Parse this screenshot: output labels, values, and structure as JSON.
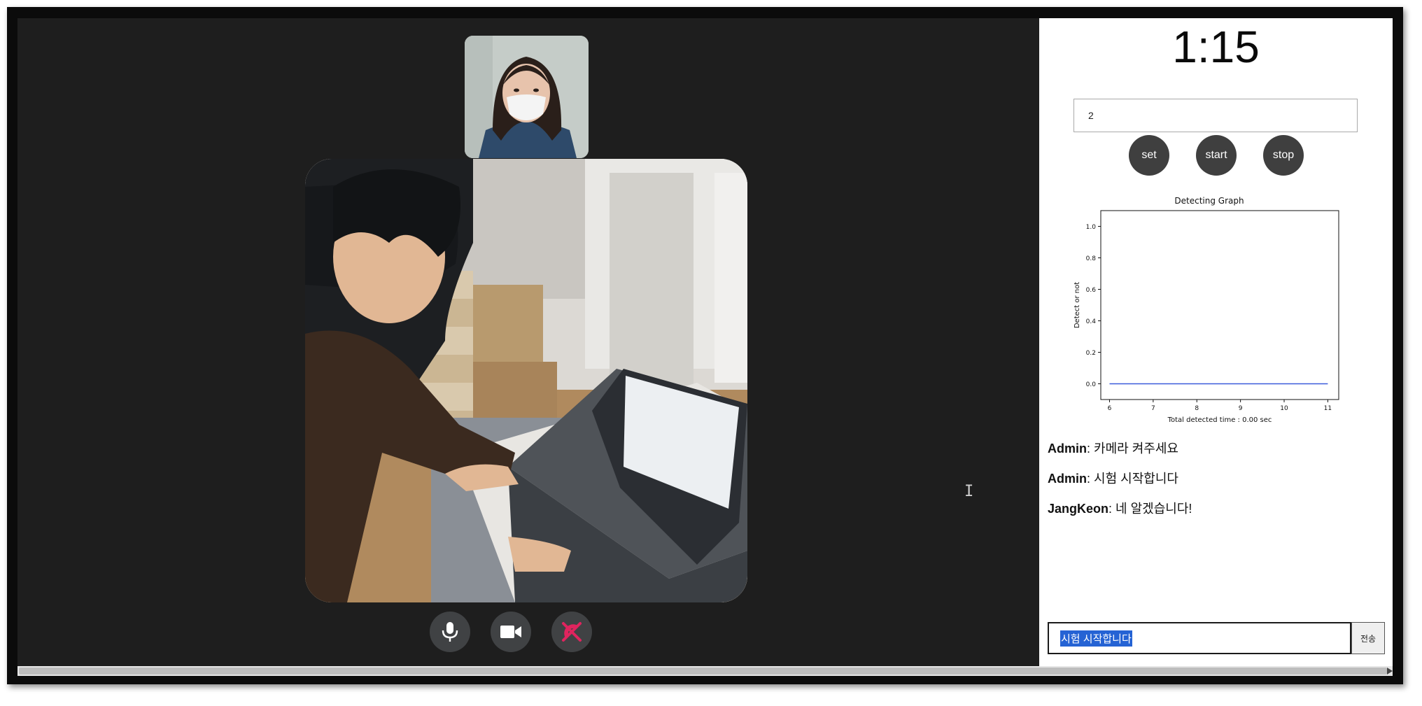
{
  "controls": {
    "mic_icon": "microphone-icon",
    "camera_icon": "video-camera-icon",
    "hangup_icon": "end-call-icon",
    "hangup_color": "#e0245e"
  },
  "panel": {
    "timer": "1:15",
    "count_value": "2",
    "set_label": "set",
    "start_label": "start",
    "stop_label": "stop"
  },
  "chart_data": {
    "type": "line",
    "title": "Detecting Graph",
    "xlabel": "Total detected time : 0.00 sec",
    "ylabel": "Detect or not",
    "xlim": [
      5.8,
      11.25
    ],
    "ylim": [
      -0.1,
      1.1
    ],
    "x_ticks": [
      6,
      7,
      8,
      9,
      10,
      11
    ],
    "y_ticks": [
      0.0,
      0.2,
      0.4,
      0.6,
      0.8,
      1.0
    ],
    "y_tick_labels": [
      "0.0",
      "0.2",
      "0.4",
      "0.6",
      "0.8",
      "1.0"
    ],
    "series": [
      {
        "x": [
          6,
          7,
          8,
          9,
          10,
          11
        ],
        "values": [
          0,
          0,
          0,
          0,
          0,
          0
        ],
        "color": "#3b5bdb"
      }
    ],
    "grid": false,
    "legend": "none"
  },
  "chat": {
    "messages": [
      {
        "user": "Admin",
        "text": "카메라 켜주세요"
      },
      {
        "user": "Admin",
        "text": "시험 시작합니다"
      },
      {
        "user": "JangKeon",
        "text": "네 알겠습니다!"
      }
    ],
    "input_value": "시험 시작합니다",
    "send_label": "전송"
  },
  "colors": {
    "stage_bg": "#1e1e1e",
    "button_bg": "#404244",
    "selection": "#2563d4"
  }
}
